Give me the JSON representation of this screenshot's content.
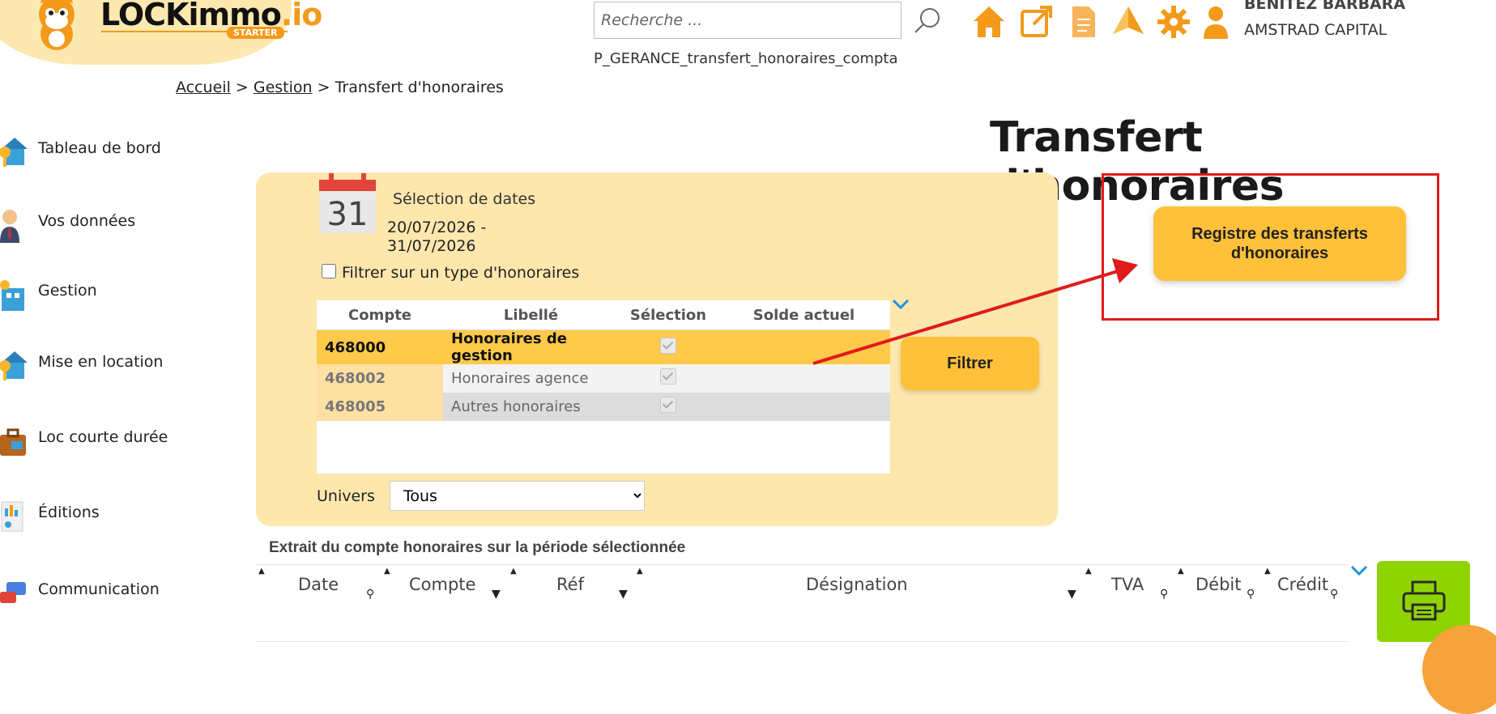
{
  "logo": {
    "brand": "LOCKimmo",
    "suffix": ".io",
    "badge": "STARTER"
  },
  "header": {
    "search_placeholder": "Recherche ...",
    "page_code": "P_GERANCE_transfert_honoraires_compta",
    "icons": [
      "home-icon",
      "external-link-icon",
      "document-icon",
      "navigation-icon",
      "gear-icon",
      "user-icon"
    ],
    "user_name": "BENITEZ BARBARA",
    "user_company": "AMSTRAD CAPITAL",
    "accent_color": "#f39a1b"
  },
  "breadcrumb": {
    "home": "Accueil",
    "section": "Gestion",
    "current": "Transfert d'honoraires",
    "separator": ">"
  },
  "sidebar": {
    "items": [
      {
        "label": "Tableau de bord",
        "icon": "dashboard-icon"
      },
      {
        "label": "Vos données",
        "icon": "person-icon"
      },
      {
        "label": "Gestion",
        "icon": "management-icon"
      },
      {
        "label": "Mise en location",
        "icon": "house-key-icon"
      },
      {
        "label": "Loc courte durée",
        "icon": "suitcase-icon"
      },
      {
        "label": "Éditions",
        "icon": "report-icon"
      },
      {
        "label": "Communication",
        "icon": "chat-icon"
      }
    ]
  },
  "page_title": "Transfert d'honoraires",
  "filters": {
    "calendar_day": "31",
    "date_label": "Sélection de dates",
    "date_range": "20/07/2026 -\n31/07/2026",
    "type_filter_label": "Filtrer sur un type d'honoraires",
    "columns": [
      "Compte",
      "Libellé",
      "Sélection",
      "Solde actuel"
    ],
    "rows": [
      {
        "compte": "468000",
        "libelle": "Honoraires de gestion",
        "selected": true,
        "solde": ""
      },
      {
        "compte": "468002",
        "libelle": "Honoraires agence",
        "selected": true,
        "solde": ""
      },
      {
        "compte": "468005",
        "libelle": "Autres honoraires",
        "selected": true,
        "solde": ""
      }
    ],
    "filter_button": "Filtrer",
    "univers_label": "Univers",
    "univers_value": "Tous"
  },
  "registre_button": "Registre des transferts d'honoraires",
  "extract": {
    "title": "Extrait du compte honoraires sur la période sélectionnée",
    "columns": [
      "Date",
      "Compte",
      "Réf",
      "Désignation",
      "TVA",
      "Débit",
      "Crédit"
    ]
  },
  "colors": {
    "button": "#ffc03a",
    "panel": "#fde7ad",
    "highlight": "#e01b1b",
    "print": "#8fd400"
  }
}
